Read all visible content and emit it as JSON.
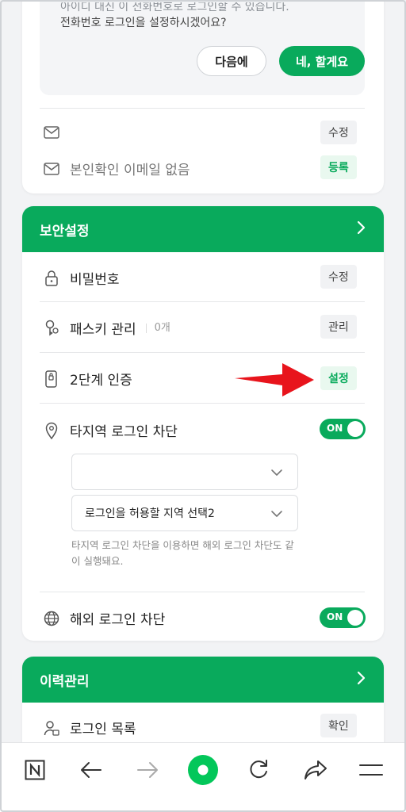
{
  "email_card": {
    "prompt_line1": "아이디 대신 이 전화번호로 로그인할 수 있습니다.",
    "prompt_line2": "전화번호 로그인을 설정하시겠어요?",
    "later_label": "다음에",
    "yes_label": "네, 할게요",
    "rows": [
      {
        "label": "",
        "action": "수정"
      },
      {
        "label": "본인확인 이메일 없음",
        "action": "등록"
      }
    ]
  },
  "security": {
    "header": "보안설정",
    "rows": {
      "password": {
        "label": "비밀번호",
        "action": "수정"
      },
      "passkey": {
        "label": "패스키 관리",
        "sub": "0개",
        "action": "관리"
      },
      "two_factor": {
        "label": "2단계 인증",
        "action": "설정"
      },
      "region_block": {
        "label": "타지역 로그인 차단",
        "toggle": "ON"
      },
      "overseas_block": {
        "label": "해외 로그인 차단",
        "toggle": "ON"
      }
    },
    "select1": "",
    "select2": "로그인을 허용할 지역 선택2",
    "note": "타지역 로그인 차단을 이용하면 해외 로그인 차단도 같이 실행돼요."
  },
  "history": {
    "header": "이력관리",
    "rows": {
      "login_list": {
        "label": "로그인 목록",
        "action": "확인"
      }
    }
  },
  "colors": {
    "accent": "#09aa5c",
    "arrow": "#e8141c"
  },
  "bottom_nav": [
    "naver-home-icon",
    "back-icon",
    "forward-icon",
    "green-dot-icon",
    "refresh-icon",
    "share-icon",
    "menu-icon"
  ]
}
